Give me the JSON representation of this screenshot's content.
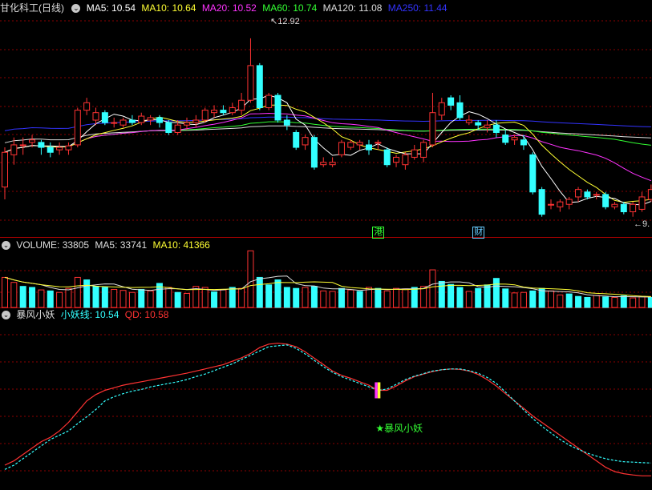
{
  "stock": {
    "name": "甘化科工",
    "period": "(日线)"
  },
  "main_legend": [
    {
      "label": "MA5: 10.54",
      "color": "#ffffff"
    },
    {
      "label": "MA10: 10.64",
      "color": "#ffff33"
    },
    {
      "label": "MA20: 10.52",
      "color": "#ff33ff"
    },
    {
      "label": "MA60: 10.74",
      "color": "#33ff33"
    },
    {
      "label": "MA120: 11.08",
      "color": "#dddddd"
    },
    {
      "label": "MA250: 11.44",
      "color": "#3333ff"
    }
  ],
  "volume_legend": [
    {
      "label": "VOLUME: 33805",
      "color": "#dddddd"
    },
    {
      "label": "MA5: 33741",
      "color": "#dddddd"
    },
    {
      "label": "MA10: 41366",
      "color": "#ffff33"
    }
  ],
  "indicator_legend": [
    {
      "label": "暴风小妖",
      "color": "#dddddd"
    },
    {
      "label": "小妖线: 10.54",
      "color": "#33ffff"
    },
    {
      "label": "QD: 10.58",
      "color": "#ff3333"
    }
  ],
  "annotations": {
    "high_label": "12.92",
    "low_label": "9."
  },
  "event_tags": [
    {
      "text": "港",
      "color": "#33ff33",
      "index": 41
    },
    {
      "text": "财",
      "color": "#66ccff",
      "index": 52
    }
  ],
  "signal": {
    "text": "★暴风小妖",
    "index": 41
  },
  "colors": {
    "up": "#ff3333",
    "down": "#33ffff",
    "grid": "#8b0000",
    "divider": "#aa0000"
  },
  "chart_data": {
    "type": "candlestick",
    "price_range": [
      9.2,
      13.4
    ],
    "candles": [
      [
        9.95,
        10.65,
        9.7,
        10.75
      ],
      [
        10.6,
        10.8,
        10.4,
        10.95
      ],
      [
        10.8,
        10.8,
        10.6,
        10.95
      ],
      [
        10.85,
        10.9,
        10.75,
        11.0
      ],
      [
        10.85,
        10.75,
        10.6,
        10.9
      ],
      [
        10.75,
        10.65,
        10.55,
        10.85
      ],
      [
        10.7,
        10.75,
        10.6,
        10.85
      ],
      [
        10.7,
        10.78,
        10.6,
        10.85
      ],
      [
        10.8,
        11.5,
        10.75,
        11.55
      ],
      [
        11.5,
        11.65,
        11.4,
        11.75
      ],
      [
        11.3,
        11.45,
        11.2,
        11.55
      ],
      [
        11.45,
        11.25,
        11.2,
        11.5
      ],
      [
        11.25,
        11.25,
        11.15,
        11.35
      ],
      [
        11.2,
        11.3,
        11.15,
        11.35
      ],
      [
        11.3,
        11.25,
        11.2,
        11.4
      ],
      [
        11.25,
        11.38,
        11.2,
        11.45
      ],
      [
        11.3,
        11.35,
        11.2,
        11.4
      ],
      [
        11.35,
        11.25,
        11.15,
        11.4
      ],
      [
        11.25,
        11.05,
        11.0,
        11.3
      ],
      [
        11.05,
        11.2,
        11.0,
        11.3
      ],
      [
        11.2,
        11.25,
        11.1,
        11.35
      ],
      [
        11.25,
        11.3,
        11.15,
        11.4
      ],
      [
        11.3,
        11.5,
        11.25,
        11.55
      ],
      [
        11.45,
        11.5,
        11.35,
        11.6
      ],
      [
        11.5,
        11.45,
        11.4,
        11.6
      ],
      [
        11.45,
        11.55,
        11.4,
        11.65
      ],
      [
        11.5,
        11.7,
        11.4,
        11.85
      ],
      [
        11.7,
        12.4,
        11.65,
        12.95
      ],
      [
        12.4,
        11.55,
        11.5,
        12.45
      ],
      [
        11.55,
        11.8,
        11.5,
        11.85
      ],
      [
        11.8,
        11.3,
        11.25,
        11.85
      ],
      [
        11.3,
        11.2,
        11.1,
        11.4
      ],
      [
        11.05,
        10.75,
        10.7,
        11.1
      ],
      [
        10.8,
        10.95,
        10.7,
        11.0
      ],
      [
        10.95,
        10.35,
        10.3,
        11.0
      ],
      [
        10.4,
        10.45,
        10.35,
        10.55
      ],
      [
        10.4,
        10.45,
        10.35,
        10.55
      ],
      [
        10.6,
        10.85,
        10.55,
        10.9
      ],
      [
        10.75,
        10.85,
        10.7,
        10.9
      ],
      [
        10.8,
        10.85,
        10.7,
        10.9
      ],
      [
        10.8,
        10.7,
        10.6,
        10.9
      ],
      [
        10.85,
        10.85,
        10.7,
        10.9
      ],
      [
        10.7,
        10.4,
        10.35,
        10.75
      ],
      [
        10.45,
        10.55,
        10.35,
        10.6
      ],
      [
        10.4,
        10.6,
        10.3,
        10.65
      ],
      [
        10.55,
        10.7,
        10.5,
        10.8
      ],
      [
        10.55,
        10.85,
        10.45,
        10.9
      ],
      [
        10.8,
        11.45,
        10.75,
        11.85
      ],
      [
        11.4,
        11.65,
        11.3,
        11.75
      ],
      [
        11.75,
        11.6,
        11.5,
        11.8
      ],
      [
        11.65,
        11.35,
        11.3,
        11.8
      ],
      [
        11.25,
        11.3,
        11.2,
        11.4
      ],
      [
        11.25,
        11.2,
        11.1,
        11.3
      ],
      [
        11.15,
        11.2,
        11.05,
        11.3
      ],
      [
        11.2,
        11.05,
        10.95,
        11.3
      ],
      [
        11.0,
        10.85,
        10.8,
        11.1
      ],
      [
        10.9,
        10.95,
        10.8,
        11.0
      ],
      [
        10.9,
        10.8,
        10.7,
        11.0
      ],
      [
        10.6,
        9.85,
        9.8,
        10.65
      ],
      [
        9.9,
        9.4,
        9.35,
        9.95
      ],
      [
        9.6,
        9.6,
        9.5,
        9.7
      ],
      [
        9.55,
        9.65,
        9.45,
        9.7
      ],
      [
        9.6,
        9.7,
        9.5,
        9.75
      ],
      [
        9.75,
        9.9,
        9.65,
        9.95
      ],
      [
        9.85,
        9.75,
        9.7,
        9.9
      ],
      [
        9.8,
        9.8,
        9.7,
        9.85
      ],
      [
        9.8,
        9.55,
        9.5,
        9.85
      ],
      [
        9.55,
        9.6,
        9.5,
        9.65
      ],
      [
        9.6,
        9.45,
        9.4,
        9.65
      ],
      [
        9.45,
        9.6,
        9.35,
        9.65
      ],
      [
        9.5,
        9.75,
        9.45,
        9.85
      ],
      [
        9.7,
        9.9,
        9.65,
        10.0
      ]
    ],
    "volume_range": [
      0,
      115000
    ],
    "volumes": [
      [
        60000,
        1
      ],
      [
        50000,
        1
      ],
      [
        42000,
        0
      ],
      [
        40000,
        0
      ],
      [
        35000,
        1
      ],
      [
        33000,
        0
      ],
      [
        30000,
        1
      ],
      [
        38000,
        1
      ],
      [
        60000,
        1
      ],
      [
        55000,
        0
      ],
      [
        42000,
        0
      ],
      [
        40000,
        0
      ],
      [
        36000,
        1
      ],
      [
        34000,
        1
      ],
      [
        30000,
        1
      ],
      [
        36000,
        0
      ],
      [
        33000,
        1
      ],
      [
        48000,
        0
      ],
      [
        40000,
        1
      ],
      [
        30000,
        0
      ],
      [
        28000,
        1
      ],
      [
        42000,
        1
      ],
      [
        40000,
        1
      ],
      [
        31000,
        0
      ],
      [
        35000,
        1
      ],
      [
        40000,
        0
      ],
      [
        38000,
        1
      ],
      [
        113000,
        1
      ],
      [
        60000,
        0
      ],
      [
        45000,
        0
      ],
      [
        55000,
        0
      ],
      [
        40000,
        0
      ],
      [
        38000,
        0
      ],
      [
        40000,
        1
      ],
      [
        42000,
        0
      ],
      [
        33000,
        1
      ],
      [
        32000,
        1
      ],
      [
        38000,
        0
      ],
      [
        35000,
        1
      ],
      [
        32000,
        0
      ],
      [
        40000,
        1
      ],
      [
        38000,
        0
      ],
      [
        33000,
        1
      ],
      [
        38000,
        1
      ],
      [
        37000,
        1
      ],
      [
        40000,
        0
      ],
      [
        42000,
        1
      ],
      [
        75000,
        1
      ],
      [
        52000,
        0
      ],
      [
        46000,
        0
      ],
      [
        40000,
        0
      ],
      [
        32000,
        1
      ],
      [
        38000,
        0
      ],
      [
        45000,
        0
      ],
      [
        58000,
        0
      ],
      [
        37000,
        0
      ],
      [
        29000,
        1
      ],
      [
        30000,
        1
      ],
      [
        33000,
        0
      ],
      [
        38000,
        0
      ],
      [
        33000,
        1
      ],
      [
        25000,
        1
      ],
      [
        27000,
        0
      ],
      [
        22000,
        0
      ],
      [
        20000,
        0
      ],
      [
        24000,
        1
      ],
      [
        21000,
        0
      ],
      [
        20000,
        1
      ],
      [
        23000,
        0
      ],
      [
        19000,
        1
      ],
      [
        22000,
        1
      ],
      [
        20000,
        0
      ]
    ],
    "indicator_range": [
      9.5,
      13.3
    ],
    "qd": [
      9.95,
      10.05,
      10.2,
      10.35,
      10.5,
      10.6,
      10.75,
      10.95,
      11.2,
      11.45,
      11.6,
      11.7,
      11.76,
      11.82,
      11.86,
      11.9,
      11.94,
      11.98,
      12.02,
      12.06,
      12.1,
      12.15,
      12.2,
      12.25,
      12.3,
      12.38,
      12.46,
      12.56,
      12.7,
      12.78,
      12.8,
      12.78,
      12.72,
      12.6,
      12.45,
      12.3,
      12.15,
      12.05,
      11.98,
      11.9,
      11.82,
      11.7,
      11.7,
      11.8,
      11.92,
      12.02,
      12.08,
      12.14,
      12.18,
      12.2,
      12.19,
      12.15,
      12.07,
      11.95,
      11.8,
      11.62,
      11.45,
      11.28,
      11.1,
      10.95,
      10.8,
      10.65,
      10.5,
      10.35,
      10.2,
      10.05,
      9.9,
      9.8,
      9.75,
      9.72,
      9.7,
      9.7
    ],
    "line": [
      9.85,
      9.95,
      10.1,
      10.25,
      10.4,
      10.55,
      10.65,
      10.75,
      10.92,
      11.08,
      11.25,
      11.45,
      11.55,
      11.62,
      11.68,
      11.72,
      11.78,
      11.82,
      11.86,
      11.9,
      11.95,
      12.02,
      12.08,
      12.16,
      12.24,
      12.32,
      12.42,
      12.52,
      12.62,
      12.72,
      12.74,
      12.76,
      12.68,
      12.55,
      12.4,
      12.25,
      12.12,
      12.02,
      11.94,
      11.86,
      11.78,
      11.7,
      11.73,
      11.84,
      11.95,
      12.03,
      12.09,
      12.15,
      12.18,
      12.2,
      12.2,
      12.16,
      12.1,
      12.0,
      11.86,
      11.66,
      11.45,
      11.24,
      11.04,
      10.86,
      10.7,
      10.55,
      10.42,
      10.32,
      10.23,
      10.16,
      10.1,
      10.06,
      10.03,
      10.02,
      10.01,
      10.0
    ]
  }
}
